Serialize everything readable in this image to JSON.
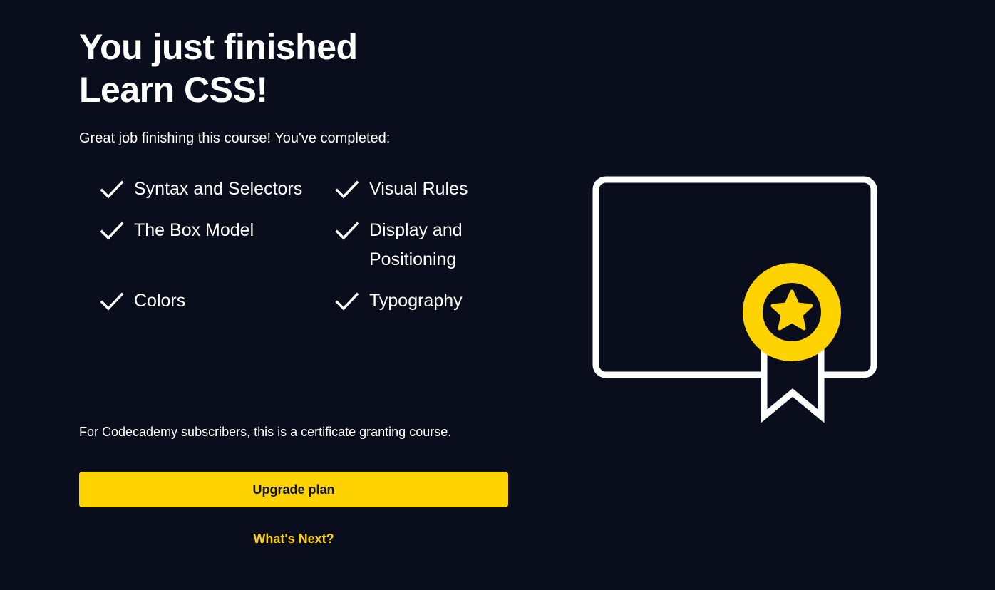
{
  "completion": {
    "title_line1": "You just finished",
    "title_line2": "Learn CSS!",
    "subtitle": "Great job finishing this course! You've completed:"
  },
  "topics": [
    {
      "label": "Syntax and Selectors"
    },
    {
      "label": "Visual Rules"
    },
    {
      "label": "The Box Model"
    },
    {
      "label": "Display and Positioning"
    },
    {
      "label": "Colors"
    },
    {
      "label": "Typography"
    }
  ],
  "footer": {
    "note": "For Codecademy subscribers, this is a certificate granting course.",
    "upgrade_label": "Upgrade plan",
    "next_label": "What's Next?"
  },
  "icons": {
    "check": "check-icon",
    "certificate": "certificate-icon",
    "badge": "award-star-icon"
  },
  "colors": {
    "background": "#0a0d1c",
    "accent": "#ffd300",
    "text": "#ffffff"
  }
}
